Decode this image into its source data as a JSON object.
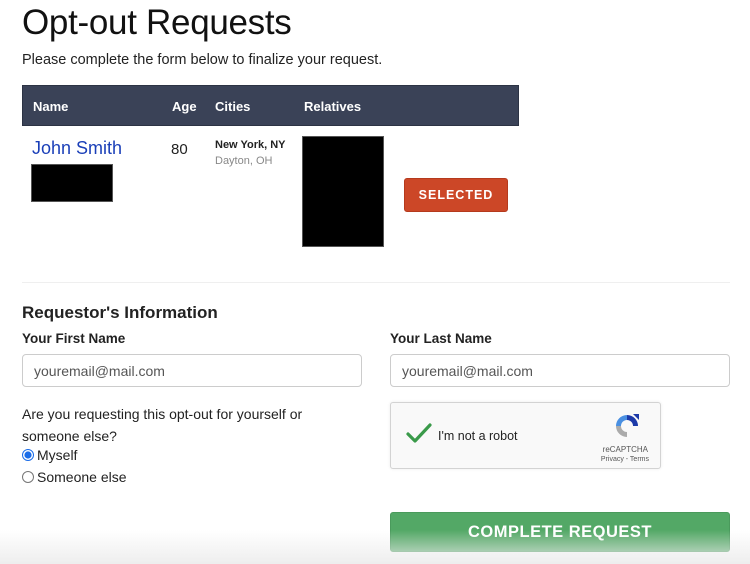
{
  "page": {
    "title": "Opt-out Requests",
    "subtitle": "Please complete the form below to finalize your request."
  },
  "table": {
    "columns": [
      "Name",
      "Age",
      "Cities",
      "Relatives"
    ],
    "row": {
      "name": "John Smith",
      "age": "80",
      "cities": [
        "New York, NY",
        "Dayton, OH"
      ],
      "selected_label": "SELECTED"
    }
  },
  "form": {
    "section_title": "Requestor's Information",
    "first_name_label": "Your First Name",
    "first_name_placeholder": "youremail@mail.com",
    "last_name_label": "Your Last Name",
    "last_name_placeholder": "youremail@mail.com",
    "question": "Are you requesting this opt-out for yourself or someone else?",
    "options": [
      {
        "label": "Myself",
        "checked": true
      },
      {
        "label": "Someone else",
        "checked": false
      }
    ],
    "captcha": {
      "label": "I'm not a robot",
      "brand": "reCAPTCHA",
      "links": "Privacy - Terms",
      "checked": true
    },
    "submit_label": "COMPLETE REQUEST"
  },
  "colors": {
    "header_bg": "#3a4257",
    "selected": "#cc4727",
    "submit": "#53a866",
    "link": "#1a3fb8"
  }
}
